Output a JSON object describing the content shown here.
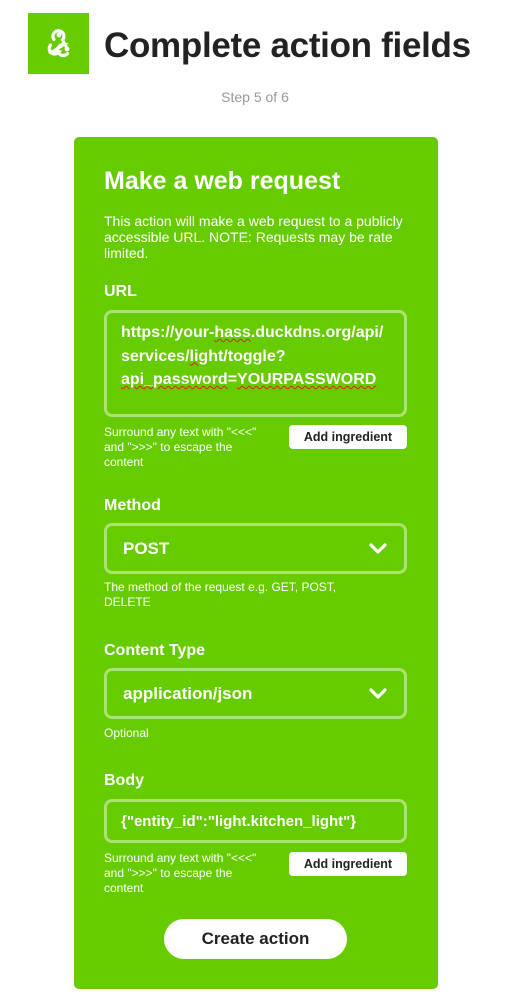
{
  "header": {
    "title": "Complete action fields",
    "step": "Step 5 of 6",
    "service_icon": "webhooks-icon",
    "brand_color": "#66cc00"
  },
  "action": {
    "title": "Make a web request",
    "description": "This action will make a web request to a publicly accessible URL. NOTE: Requests may be rate limited.",
    "fields": {
      "url": {
        "label": "URL",
        "value_parts": [
          "https://your-",
          "hass",
          ".duckdns.org/api/services/",
          "lig",
          "ht/toggle?",
          "api_password",
          "=",
          "YOURPASSWORD"
        ],
        "helper": "Surround any text with \"<<<\" and \">>>\" to escape the content",
        "ingredient_label": "Add ingredient"
      },
      "method": {
        "label": "Method",
        "value": "POST",
        "helper": "The method of the request e.g. GET, POST, DELETE"
      },
      "content_type": {
        "label": "Content Type",
        "value": "application/json",
        "helper": "Optional"
      },
      "body": {
        "label": "Body",
        "value": "{\"entity_id\":\"light.kitchen_light\"}",
        "helper": "Surround any text with \"<<<\" and \">>>\" to escape the content",
        "ingredient_label": "Add ingredient"
      }
    },
    "submit_label": "Create action"
  }
}
